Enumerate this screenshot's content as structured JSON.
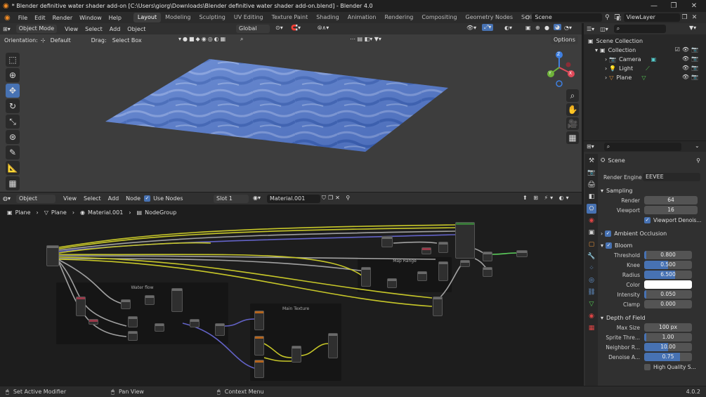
{
  "window": {
    "title": "* Blender definitive water shader add-on [C:\\Users\\giorg\\Downloads\\Blender definitive water shader add-on.blend] - Blender 4.0",
    "controls": [
      "—",
      "❐",
      "✕"
    ]
  },
  "menubar": {
    "menus": [
      "File",
      "Edit",
      "Render",
      "Window",
      "Help"
    ],
    "workspaces": [
      "Layout",
      "Modeling",
      "Sculpting",
      "UV Editing",
      "Texture Paint",
      "Shading",
      "Animation",
      "Rendering",
      "Compositing",
      "Geometry Nodes",
      "Scripting"
    ],
    "active_workspace": "Layout",
    "add_tab": "+",
    "scene_name": "Scene",
    "view_layer": "ViewLayer"
  },
  "viewport": {
    "mode": "Object Mode",
    "menus": [
      "View",
      "Select",
      "Add",
      "Object"
    ],
    "transform_orientation": "Global",
    "orientation_label": "Orientation:",
    "orientation_value": "Default",
    "drag_label": "Drag:",
    "drag_value": "Select Box",
    "options": "Options",
    "gizmo_axes": [
      "X",
      "Y",
      "Z"
    ],
    "colors": {
      "water_light": "#7a98d8",
      "water_dark": "#3a5eb0",
      "bg": "#3d3d3d"
    }
  },
  "node_editor": {
    "editor_type": "Object",
    "menus": [
      "View",
      "Select",
      "Add",
      "Node"
    ],
    "use_nodes_label": "Use Nodes",
    "slot": "Slot 1",
    "material": "Material.001",
    "breadcrumb": [
      "Plane",
      "Plane",
      "Material.001",
      "NodeGroup"
    ],
    "frames": [
      "Water flow",
      "Main Texture",
      "Map Range"
    ],
    "wire_colors": {
      "shader": "#5ccf5c",
      "color": "#c7c729",
      "float": "#a1a1a1",
      "vector": "#6363c7"
    }
  },
  "outliner": {
    "scene_collection": "Scene Collection",
    "collection": "Collection",
    "items": [
      {
        "name": "Camera",
        "color": "#e0903a"
      },
      {
        "name": "Light",
        "color": "#e0903a"
      },
      {
        "name": "Plane",
        "color": "#e0903a"
      }
    ]
  },
  "properties": {
    "context": "Scene",
    "render_engine_label": "Render Engine",
    "render_engine": "EEVEE",
    "sampling": {
      "title": "Sampling",
      "render_label": "Render",
      "render": "64",
      "viewport_label": "Viewport",
      "viewport": "16",
      "denoise_label": "Viewport Denois..."
    },
    "ambient_occlusion": "Ambient Occlusion",
    "bloom": {
      "title": "Bloom",
      "threshold_label": "Threshold",
      "threshold": "0.800",
      "threshold_frac": 0.04,
      "knee_label": "Knee",
      "knee": "0.500",
      "knee_frac": 0.5,
      "radius_label": "Radius",
      "radius": "6.500",
      "radius_frac": 0.65,
      "color_label": "Color",
      "color": "#ffffff",
      "intensity_label": "Intensity",
      "intensity": "0.050",
      "intensity_frac": 0.05,
      "clamp_label": "Clamp",
      "clamp": "0.000"
    },
    "depth_of_field": {
      "title": "Depth of Field",
      "max_size_label": "Max Size",
      "max_size": "100 px",
      "sprite_label": "Sprite Thre...",
      "sprite": "1.00",
      "sprite_frac": 0.05,
      "neighbor_label": "Neighbor R...",
      "neighbor": "10.00",
      "neighbor_frac": 0.5,
      "denoise_label": "Denoise A...",
      "denoise": "0.75",
      "denoise_frac": 0.75,
      "hq_label": "High Quality S..."
    }
  },
  "statusbar": {
    "items": [
      "Set Active Modifier",
      "Pan View",
      "Context Menu"
    ],
    "version": "4.0.2"
  }
}
